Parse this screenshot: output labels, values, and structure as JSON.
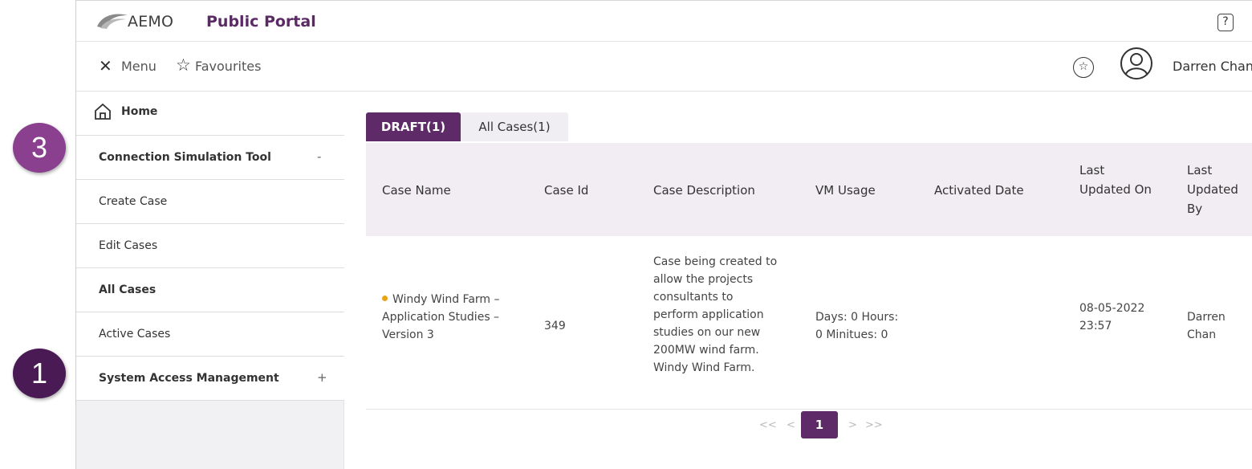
{
  "header": {
    "brand": "AEMO",
    "portal": "Public Portal",
    "help_icon": "help-icon"
  },
  "menubar": {
    "menu_label": "Menu",
    "favourites_label": "Favourites",
    "user_name": "Darren Chan"
  },
  "sidebar": {
    "home": "Home",
    "items": [
      {
        "label": "Connection Simulation Tool",
        "sign": "-"
      },
      {
        "label": "Create Case"
      },
      {
        "label": "Edit Cases"
      },
      {
        "label": "All Cases"
      },
      {
        "label": "Active Cases"
      },
      {
        "label": "System Access Management",
        "sign": "+"
      }
    ]
  },
  "callouts": {
    "three": "3",
    "one": "1"
  },
  "tabs": {
    "draft": "DRAFT(1)",
    "all": "All Cases(1)"
  },
  "table": {
    "headers": {
      "case_name": "Case Name",
      "case_id": "Case Id",
      "case_description": "Case Description",
      "vm_usage": "VM Usage",
      "activated_date": "Activated Date",
      "last_updated_on": [
        "Last",
        "Updated On"
      ],
      "last_updated_by": [
        "Last",
        "Updated",
        "By"
      ]
    },
    "row": {
      "case_name": [
        "Windy Wind Farm –",
        "Application Studies –",
        "Version 3"
      ],
      "case_id": "349",
      "case_description": [
        "Case being created to",
        "allow the projects",
        "consultants to",
        "perform application",
        "studies on our new",
        "200MW wind farm.",
        "Windy Wind Farm."
      ],
      "vm_usage": [
        "Days: 0 Hours:",
        "0 Minitues: 0"
      ],
      "activated_date": "",
      "last_updated_on": [
        "08-05-2022",
        "23:57"
      ],
      "last_updated_by": [
        "Darren",
        "Chan"
      ]
    }
  },
  "pagination": {
    "first": "<<",
    "prev": "<",
    "current": "1",
    "next": ">",
    "last": ">>"
  },
  "colors": {
    "brand_purple": "#5e2a68",
    "callout_3": "#8a3f8f",
    "callout_1": "#4a1a55",
    "status_dot": "#e8a317"
  }
}
